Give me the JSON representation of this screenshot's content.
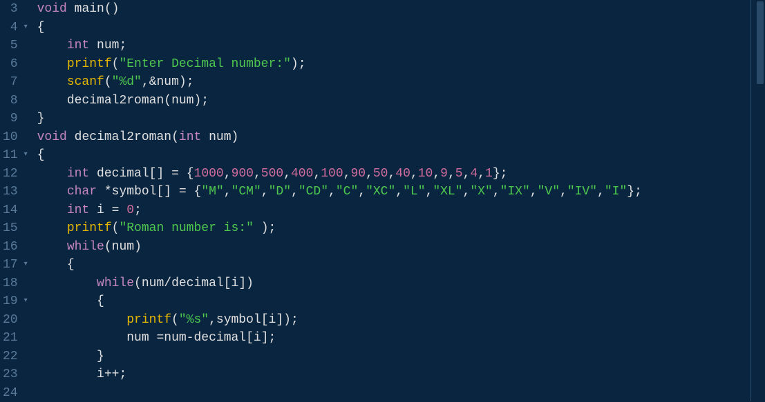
{
  "gutter": {
    "start": 3,
    "end": 24,
    "fold_lines": [
      4,
      11,
      17,
      19
    ]
  },
  "lines": {
    "l3": {
      "indent": 0,
      "tokens": [
        [
          "kw",
          "void"
        ],
        [
          "sp",
          " "
        ],
        [
          "fnname",
          "main"
        ],
        [
          "paren",
          "()"
        ]
      ]
    },
    "l4": {
      "indent": 0,
      "tokens": [
        [
          "brace",
          "{"
        ]
      ]
    },
    "l5": {
      "indent": 1,
      "tokens": [
        [
          "kw",
          "int"
        ],
        [
          "sp",
          " "
        ],
        [
          "ident",
          "num"
        ],
        [
          "op",
          ";"
        ]
      ]
    },
    "l6": {
      "indent": 1,
      "tokens": [
        [
          "call",
          "printf"
        ],
        [
          "paren",
          "("
        ],
        [
          "str",
          "\"Enter Decimal number:\""
        ],
        [
          "paren",
          ")"
        ],
        [
          "op",
          ";"
        ]
      ]
    },
    "l7": {
      "indent": 1,
      "tokens": [
        [
          "call",
          "scanf"
        ],
        [
          "paren",
          "("
        ],
        [
          "str",
          "\"%d\""
        ],
        [
          "op",
          ","
        ],
        [
          "op",
          "&"
        ],
        [
          "ident",
          "num"
        ],
        [
          "paren",
          ")"
        ],
        [
          "op",
          ";"
        ]
      ]
    },
    "l8": {
      "indent": 1,
      "tokens": [
        [
          "ident",
          "decimal2roman"
        ],
        [
          "paren",
          "("
        ],
        [
          "ident",
          "num"
        ],
        [
          "paren",
          ")"
        ],
        [
          "op",
          ";"
        ]
      ]
    },
    "l9": {
      "indent": 0,
      "tokens": [
        [
          "brace",
          "}"
        ]
      ]
    },
    "l10": {
      "indent": 0,
      "tokens": [
        [
          "kw",
          "void"
        ],
        [
          "sp",
          " "
        ],
        [
          "fnname",
          "decimal2roman"
        ],
        [
          "paren",
          "("
        ],
        [
          "kw",
          "int"
        ],
        [
          "sp",
          " "
        ],
        [
          "ident",
          "num"
        ],
        [
          "paren",
          ")"
        ]
      ]
    },
    "l11": {
      "indent": 0,
      "tokens": [
        [
          "brace",
          "{"
        ]
      ]
    },
    "l12": {
      "indent": 1,
      "tokens": [
        [
          "kw",
          "int"
        ],
        [
          "sp",
          " "
        ],
        [
          "ident",
          "decimal"
        ],
        [
          "paren",
          "[]"
        ],
        [
          "sp",
          " "
        ],
        [
          "op",
          "="
        ],
        [
          "sp",
          " "
        ],
        [
          "brace",
          "{"
        ],
        [
          "num",
          "1000"
        ],
        [
          "op",
          ","
        ],
        [
          "num",
          "900"
        ],
        [
          "op",
          ","
        ],
        [
          "num",
          "500"
        ],
        [
          "op",
          ","
        ],
        [
          "num",
          "400"
        ],
        [
          "op",
          ","
        ],
        [
          "num",
          "100"
        ],
        [
          "op",
          ","
        ],
        [
          "num",
          "90"
        ],
        [
          "op",
          ","
        ],
        [
          "num",
          "50"
        ],
        [
          "op",
          ","
        ],
        [
          "num",
          "40"
        ],
        [
          "op",
          ","
        ],
        [
          "num",
          "10"
        ],
        [
          "op",
          ","
        ],
        [
          "num",
          "9"
        ],
        [
          "op",
          ","
        ],
        [
          "num",
          "5"
        ],
        [
          "op",
          ","
        ],
        [
          "num",
          "4"
        ],
        [
          "op",
          ","
        ],
        [
          "num",
          "1"
        ],
        [
          "brace",
          "}"
        ],
        [
          "op",
          ";"
        ]
      ]
    },
    "l13": {
      "indent": 1,
      "tokens": [
        [
          "kw",
          "char"
        ],
        [
          "sp",
          " "
        ],
        [
          "op",
          "*"
        ],
        [
          "ident",
          "symbol"
        ],
        [
          "paren",
          "[]"
        ],
        [
          "sp",
          " "
        ],
        [
          "op",
          "="
        ],
        [
          "sp",
          " "
        ],
        [
          "brace",
          "{"
        ],
        [
          "str",
          "\"M\""
        ],
        [
          "op",
          ","
        ],
        [
          "str",
          "\"CM\""
        ],
        [
          "op",
          ","
        ],
        [
          "str",
          "\"D\""
        ],
        [
          "op",
          ","
        ],
        [
          "str",
          "\"CD\""
        ],
        [
          "op",
          ","
        ],
        [
          "str",
          "\"C\""
        ],
        [
          "op",
          ","
        ],
        [
          "str",
          "\"XC\""
        ],
        [
          "op",
          ","
        ],
        [
          "str",
          "\"L\""
        ],
        [
          "op",
          ","
        ],
        [
          "str",
          "\"XL\""
        ],
        [
          "op",
          ","
        ],
        [
          "str",
          "\"X\""
        ],
        [
          "op",
          ","
        ],
        [
          "str",
          "\"IX\""
        ],
        [
          "op",
          ","
        ],
        [
          "str",
          "\"V\""
        ],
        [
          "op",
          ","
        ],
        [
          "str",
          "\"IV\""
        ],
        [
          "op",
          ","
        ],
        [
          "str",
          "\"I\""
        ],
        [
          "brace",
          "}"
        ],
        [
          "op",
          ";"
        ]
      ]
    },
    "l14": {
      "indent": 1,
      "tokens": [
        [
          "kw",
          "int"
        ],
        [
          "sp",
          " "
        ],
        [
          "ident",
          "i"
        ],
        [
          "sp",
          " "
        ],
        [
          "op",
          "="
        ],
        [
          "sp",
          " "
        ],
        [
          "num",
          "0"
        ],
        [
          "op",
          ";"
        ]
      ]
    },
    "l15": {
      "indent": 1,
      "tokens": [
        [
          "call",
          "printf"
        ],
        [
          "paren",
          "("
        ],
        [
          "str",
          "\"Roman number is:\""
        ],
        [
          "sp",
          " "
        ],
        [
          "paren",
          ")"
        ],
        [
          "op",
          ";"
        ]
      ]
    },
    "l16": {
      "indent": 1,
      "tokens": [
        [
          "kw",
          "while"
        ],
        [
          "paren",
          "("
        ],
        [
          "ident",
          "num"
        ],
        [
          "paren",
          ")"
        ]
      ]
    },
    "l17": {
      "indent": 1,
      "tokens": [
        [
          "brace",
          "{"
        ]
      ]
    },
    "l18": {
      "indent": 2,
      "tokens": [
        [
          "kw",
          "while"
        ],
        [
          "paren",
          "("
        ],
        [
          "ident",
          "num"
        ],
        [
          "op",
          "/"
        ],
        [
          "ident",
          "decimal"
        ],
        [
          "paren",
          "["
        ],
        [
          "ident",
          "i"
        ],
        [
          "paren",
          "]"
        ],
        [
          "paren",
          ")"
        ]
      ]
    },
    "l19": {
      "indent": 2,
      "tokens": [
        [
          "brace",
          "{"
        ]
      ]
    },
    "l20": {
      "indent": 3,
      "tokens": [
        [
          "call",
          "printf"
        ],
        [
          "paren",
          "("
        ],
        [
          "str",
          "\"%s\""
        ],
        [
          "op",
          ","
        ],
        [
          "ident",
          "symbol"
        ],
        [
          "paren",
          "["
        ],
        [
          "ident",
          "i"
        ],
        [
          "paren",
          "]"
        ],
        [
          "paren",
          ")"
        ],
        [
          "op",
          ";"
        ]
      ]
    },
    "l21": {
      "indent": 3,
      "tokens": [
        [
          "ident",
          "num"
        ],
        [
          "sp",
          " "
        ],
        [
          "op",
          "="
        ],
        [
          "ident",
          "num"
        ],
        [
          "op",
          "-"
        ],
        [
          "ident",
          "decimal"
        ],
        [
          "paren",
          "["
        ],
        [
          "ident",
          "i"
        ],
        [
          "paren",
          "]"
        ],
        [
          "op",
          ";"
        ]
      ]
    },
    "l22": {
      "indent": 2,
      "tokens": [
        [
          "brace",
          "}"
        ]
      ]
    },
    "l23": {
      "indent": 2,
      "tokens": [
        [
          "ident",
          "i"
        ],
        [
          "op",
          "++"
        ],
        [
          "op",
          ";"
        ]
      ]
    },
    "l24": {
      "indent": 0,
      "tokens": []
    }
  },
  "indent_unit": "    "
}
